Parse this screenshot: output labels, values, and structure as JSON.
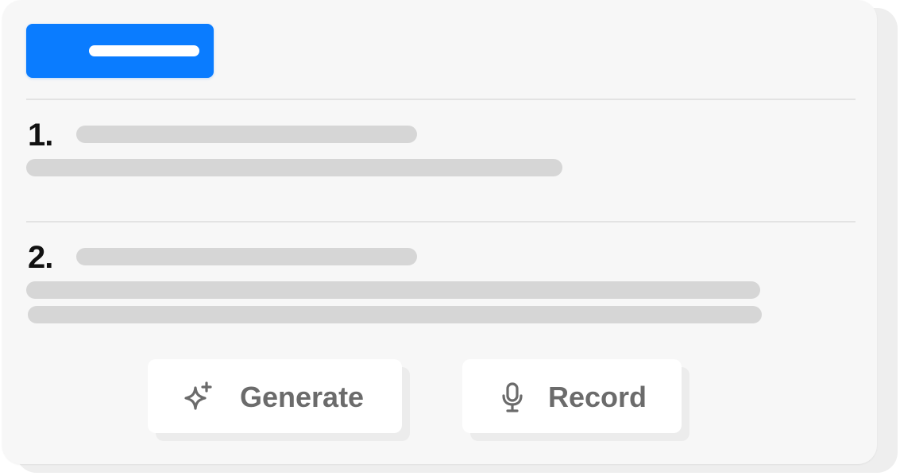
{
  "list": {
    "items": [
      {
        "number": "1."
      },
      {
        "number": "2."
      }
    ]
  },
  "actions": {
    "generate_label": "Generate",
    "generate_icon": "sparkle-icon",
    "record_label": "Record",
    "record_icon": "microphone-icon"
  },
  "colors": {
    "primary": "#0a7cff",
    "placeholder": "#d6d6d6",
    "card_bg": "#f7f7f7",
    "label": "#6b6b6b"
  }
}
